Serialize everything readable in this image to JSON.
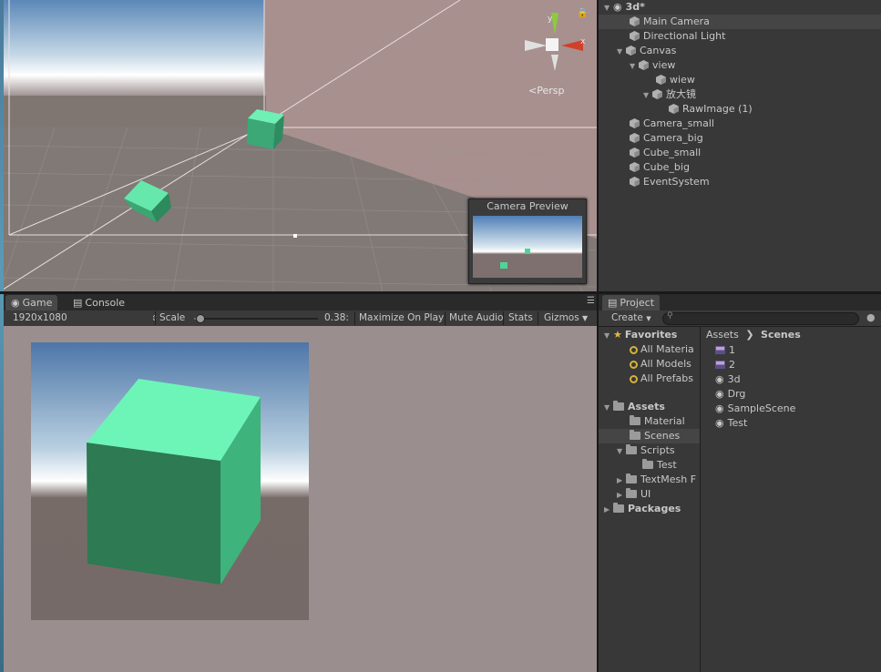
{
  "hierarchy": {
    "scene_name": "3d*",
    "items": [
      {
        "label": "Main Camera"
      },
      {
        "label": "Directional Light"
      },
      {
        "label": "Canvas"
      },
      {
        "label": "view"
      },
      {
        "label": "wiew"
      },
      {
        "label": "放大镜"
      },
      {
        "label": "RawImage (1)"
      },
      {
        "label": "Camera_small"
      },
      {
        "label": "Camera_big"
      },
      {
        "label": "Cube_small"
      },
      {
        "label": "Cube_big"
      },
      {
        "label": "EventSystem"
      }
    ]
  },
  "scene_view": {
    "gizmo_y": "y",
    "gizmo_x": "x",
    "projection": "Persp",
    "camera_preview_title": "Camera Preview"
  },
  "game_panel": {
    "tabs": [
      "Game",
      "Console"
    ],
    "resolution": "1920x1080",
    "scale_label": "Scale",
    "scale_value": "0.38:",
    "scale_fraction": 0.05,
    "maximize_on_play": "Maximize On Play",
    "mute_audio": "Mute Audio",
    "stats": "Stats",
    "gizmos": "Gizmos"
  },
  "project_panel": {
    "tab": "Project",
    "create_label": "Create",
    "breadcrumb": [
      "Assets",
      "Scenes"
    ],
    "favorites_label": "Favorites",
    "favorites": [
      "All Materia",
      "All Models",
      "All Prefabs"
    ],
    "assets_label": "Assets",
    "asset_folders": [
      "Material",
      "Scenes",
      "Scripts",
      "Test",
      "TextMesh F",
      "UI"
    ],
    "packages_label": "Packages",
    "files": [
      "1",
      "2",
      "3d",
      "Drg",
      "SampleScene",
      "Test"
    ]
  },
  "colors": {
    "cube_light": "#6df5b8",
    "cube_dark": "#2d7a53",
    "panel_bg": "#383838",
    "selection": "#454545"
  }
}
